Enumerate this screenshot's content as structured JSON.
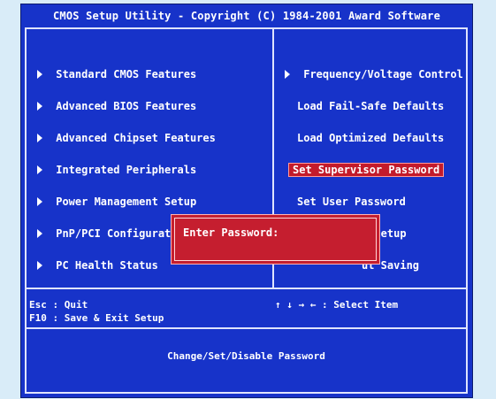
{
  "title": "CMOS Setup Utility - Copyright (C) 1984-2001 Award Software",
  "left_menu": [
    {
      "label": "Standard CMOS Features",
      "arrow": true
    },
    {
      "label": "Advanced BIOS Features",
      "arrow": true
    },
    {
      "label": "Advanced Chipset Features",
      "arrow": true
    },
    {
      "label": "Integrated Peripherals",
      "arrow": true
    },
    {
      "label": "Power Management Setup",
      "arrow": true
    },
    {
      "label": "PnP/PCI Configurati",
      "arrow": true
    },
    {
      "label": "PC Health Status",
      "arrow": true
    }
  ],
  "right_menu": [
    {
      "label": "Frequency/Voltage Control",
      "arrow": true
    },
    {
      "label": "Load Fail-Safe Defaults",
      "arrow": false
    },
    {
      "label": "Load Optimized Defaults",
      "arrow": false
    },
    {
      "label": "Set Supervisor Password",
      "arrow": false,
      "selected": true
    },
    {
      "label": "Set User Password",
      "arrow": false
    },
    {
      "label": "t Setup",
      "arrow": false
    },
    {
      "label": "ut Saving",
      "arrow": false
    }
  ],
  "help": {
    "esc_line": "Esc : Quit",
    "f10_line": "F10 : Save & Exit Setup",
    "select_line": "↑ ↓ → ←   : Select Item"
  },
  "status": {
    "text": "Change/Set/Disable Password"
  },
  "password_dialog": {
    "label": "Enter Password:"
  },
  "colors": {
    "bios_blue": "#1733c9",
    "frame_white": "#dfe4ff",
    "selection_red": "#c31b2b",
    "dialog_red": "#c51e2f"
  }
}
